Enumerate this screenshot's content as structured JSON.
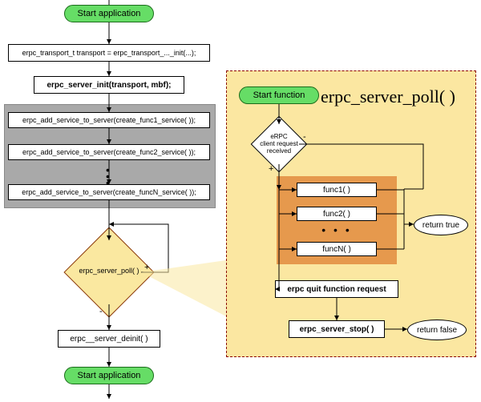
{
  "left": {
    "start": "Start application",
    "transport": "erpc_transport_t transport = erpc_transport_..._init(...);",
    "server_init": "erpc_server_init(transport, mbf);",
    "services": {
      "add1": "erpc_add_service_to_server(create_func1_service( ));",
      "add2": "erpc_add_service_to_server(create_func2_service( ));",
      "addN": "erpc_add_service_to_server(create_funcN_service( ));"
    },
    "poll_decision": "erpc_server_poll( )",
    "poll_plus": "+",
    "poll_minus": "-",
    "deinit": "erpc__server_deinit( )",
    "end": "Start application"
  },
  "right": {
    "title": "erpc_server_poll( )",
    "start": "Start function",
    "request_decision": "eRPC\nclient request\nreceived",
    "plus": "+",
    "minus": "-",
    "funcs": {
      "f1": "func1( )",
      "f2": "func2( )",
      "fN": "funcN( )"
    },
    "return_true": "return true",
    "quit": "erpc quit function request",
    "stop": "erpc_server_stop( )",
    "return_false": "return false"
  }
}
